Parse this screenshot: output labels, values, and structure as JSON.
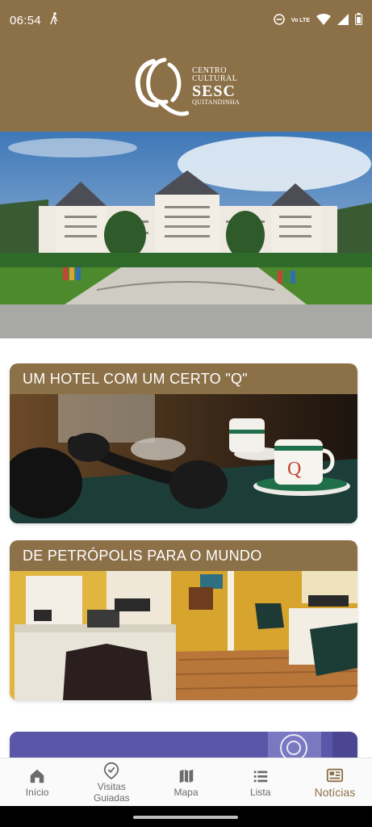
{
  "status_bar": {
    "time": "06:54",
    "network_label": "Vo LTE"
  },
  "header": {
    "logo": {
      "line1": "CENTRO",
      "line2": "CULTURAL",
      "line3": "SESC",
      "line4": "QUITANDINHA"
    }
  },
  "cards": [
    {
      "title": "UM HOTEL COM UM CERTO \"Q\""
    },
    {
      "title": "DE PETRÓPOLIS PARA O MUNDO"
    }
  ],
  "nav": {
    "items": [
      {
        "label": "Início",
        "icon": "home-icon"
      },
      {
        "label": "Visitas Guiadas",
        "icon": "tour-icon"
      },
      {
        "label": "Mapa",
        "icon": "map-icon"
      },
      {
        "label": "Lista",
        "icon": "list-icon"
      },
      {
        "label": "Notícias",
        "icon": "news-icon",
        "active": true
      }
    ]
  },
  "colors": {
    "brand": "#8c7048",
    "nav_inactive": "#6b6b6b"
  }
}
